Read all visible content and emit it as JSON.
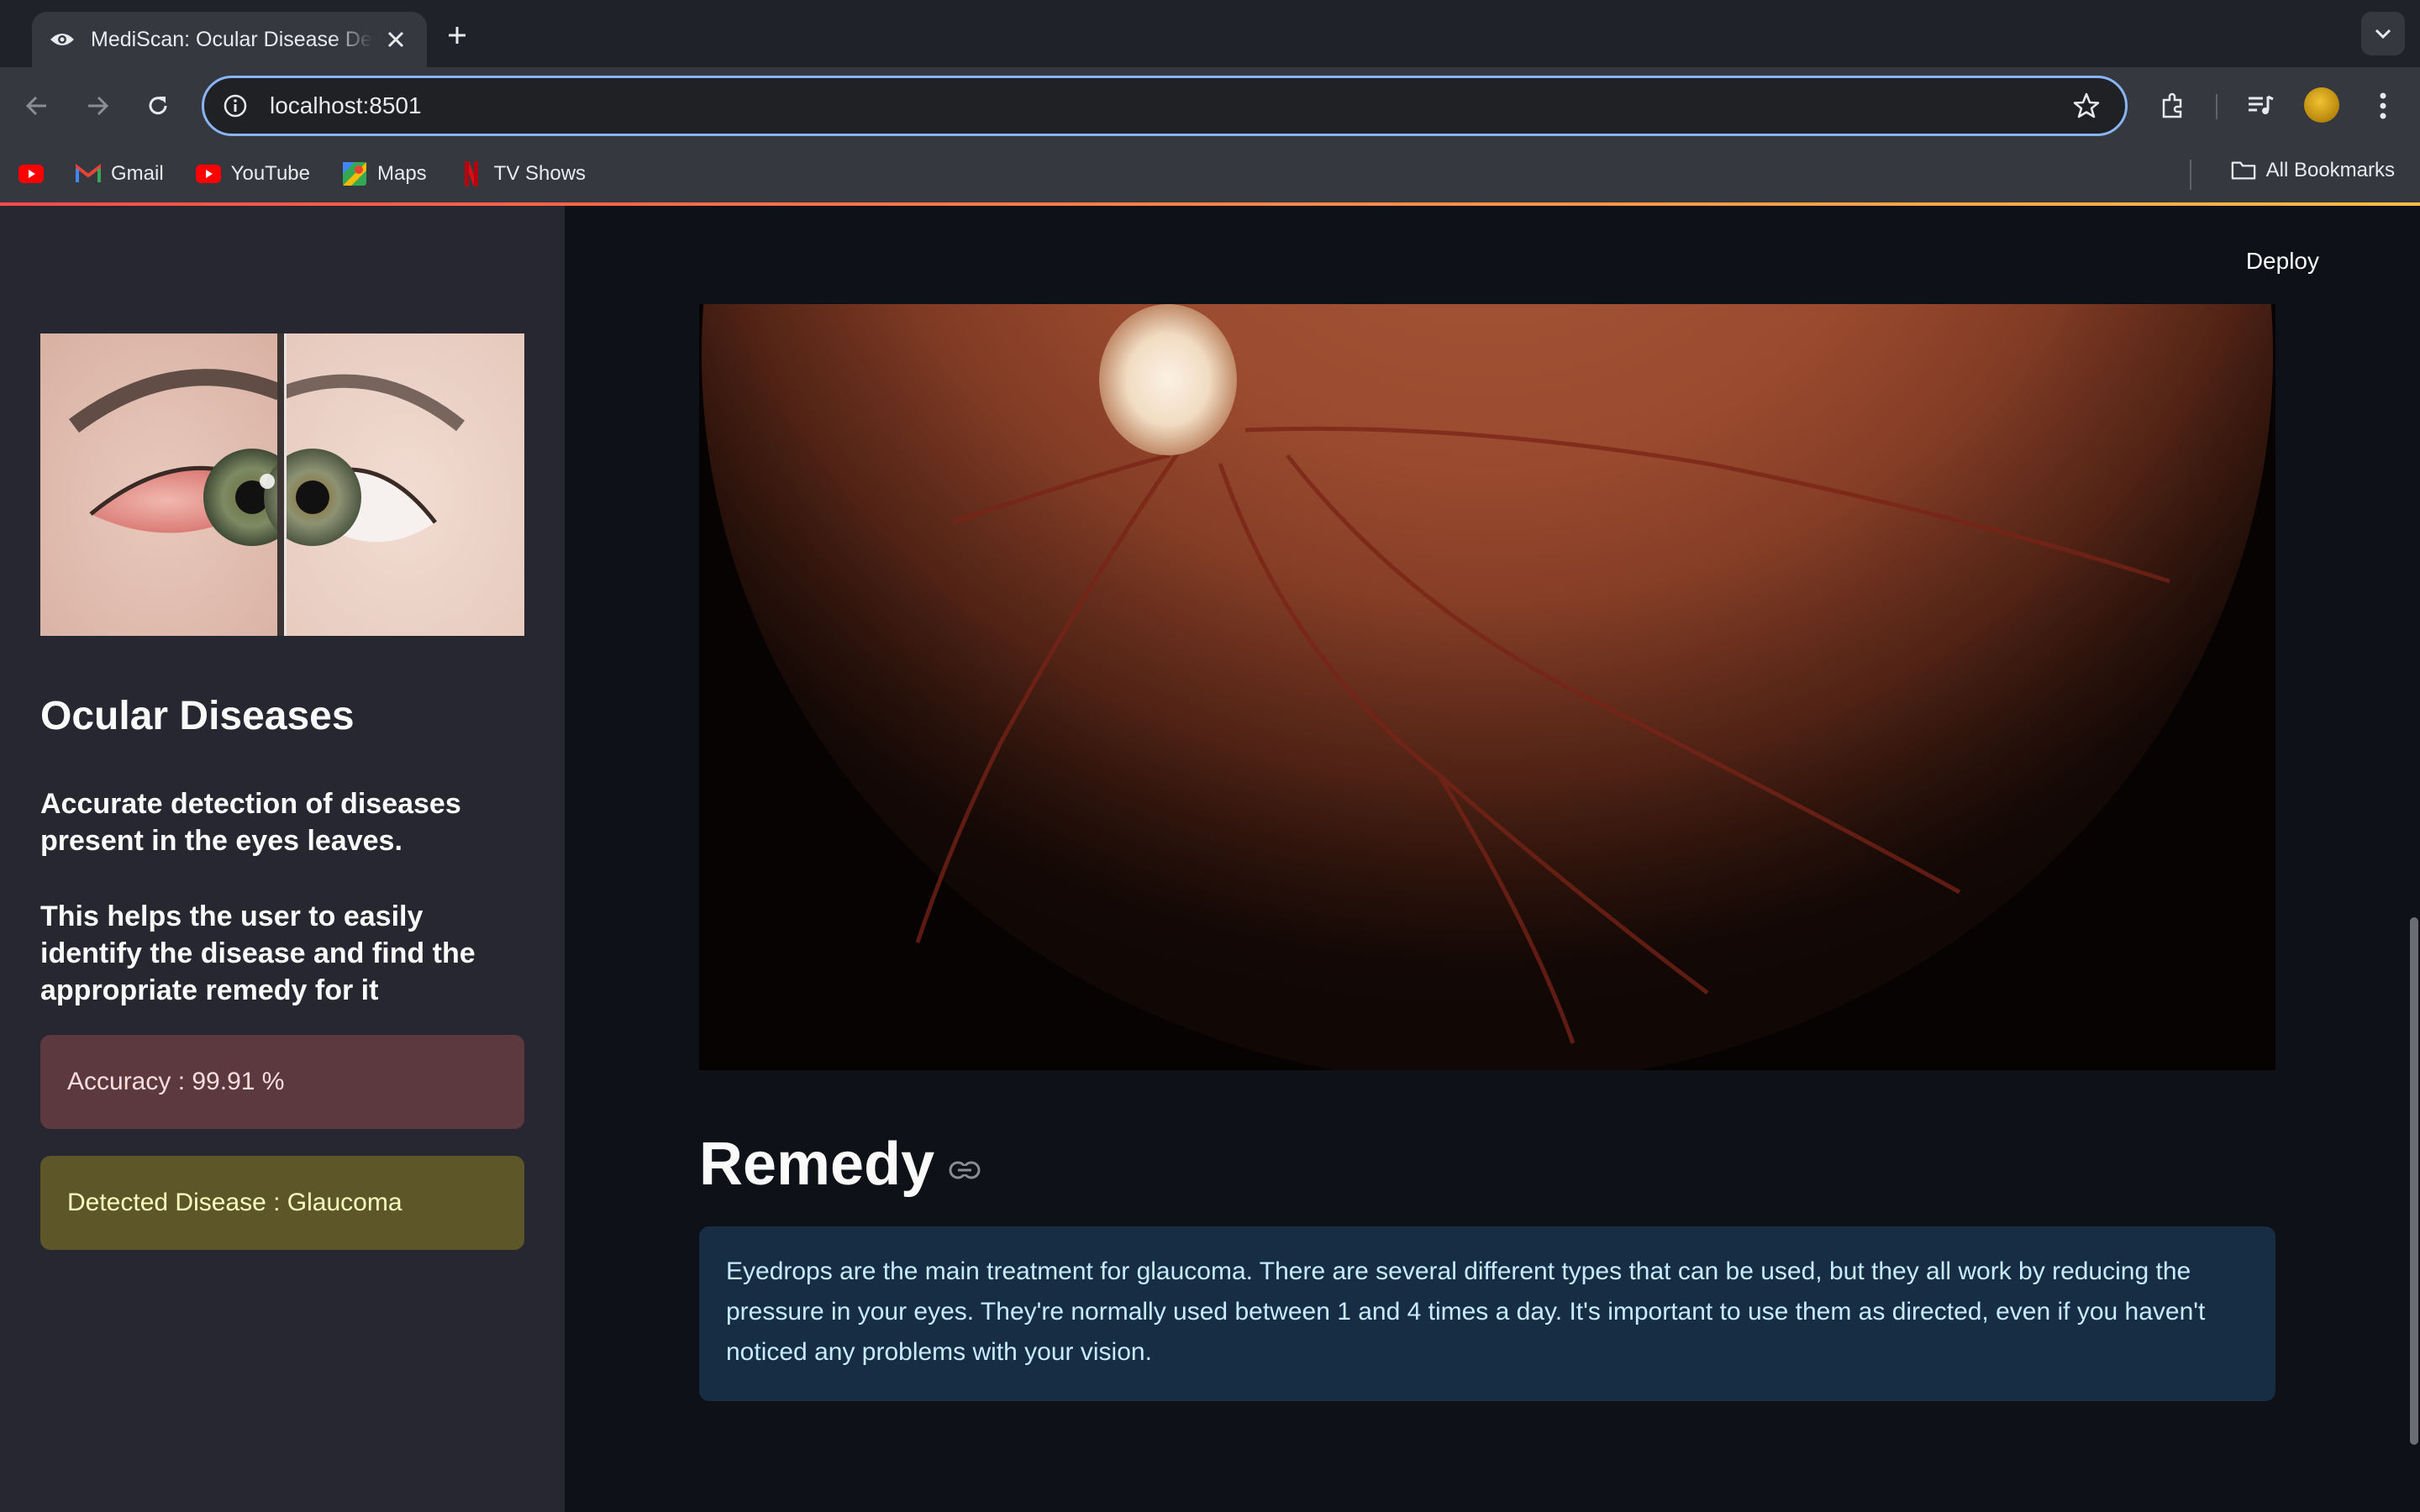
{
  "browser": {
    "tab": {
      "title": "MediScan: Ocular Disease Detection",
      "favicon": "eye-icon"
    },
    "url": "localhost:8501",
    "bookmarks": [
      {
        "label": "",
        "icon": "youtube-icon"
      },
      {
        "label": "Gmail",
        "icon": "gmail-icon"
      },
      {
        "label": "YouTube",
        "icon": "youtube-icon"
      },
      {
        "label": "Maps",
        "icon": "maps-icon"
      },
      {
        "label": "TV Shows",
        "icon": "netflix-icon"
      }
    ],
    "all_bookmarks": "All Bookmarks"
  },
  "sidebar": {
    "title": "Ocular Diseases",
    "paragraph1": "Accurate detection of diseases present in the eyes leaves.",
    "paragraph2": "This helps the user to easily identify the disease and find the appropriate remedy for it",
    "accuracy": "Accuracy : 99.91 %",
    "detected": "Detected Disease : Glaucoma"
  },
  "main": {
    "deploy_label": "Deploy",
    "remedy_heading": "Remedy",
    "remedy_text": "Eyedrops are the main treatment for glaucoma. There are several different types that can be used, but they all work by reducing the pressure in your eyes. They're normally used between 1 and 4 times a day. It's important to use them as directed, even if you haven't noticed any problems with your vision."
  },
  "colors": {
    "app_bg": "#0e1117",
    "sidebar_bg": "#262730",
    "error_alert": "#ff6c6c",
    "warning_alert": "#ffe312",
    "info_box": "#172d43",
    "accent_gradient": [
      "#ff4b4b",
      "#ffbd45"
    ]
  }
}
